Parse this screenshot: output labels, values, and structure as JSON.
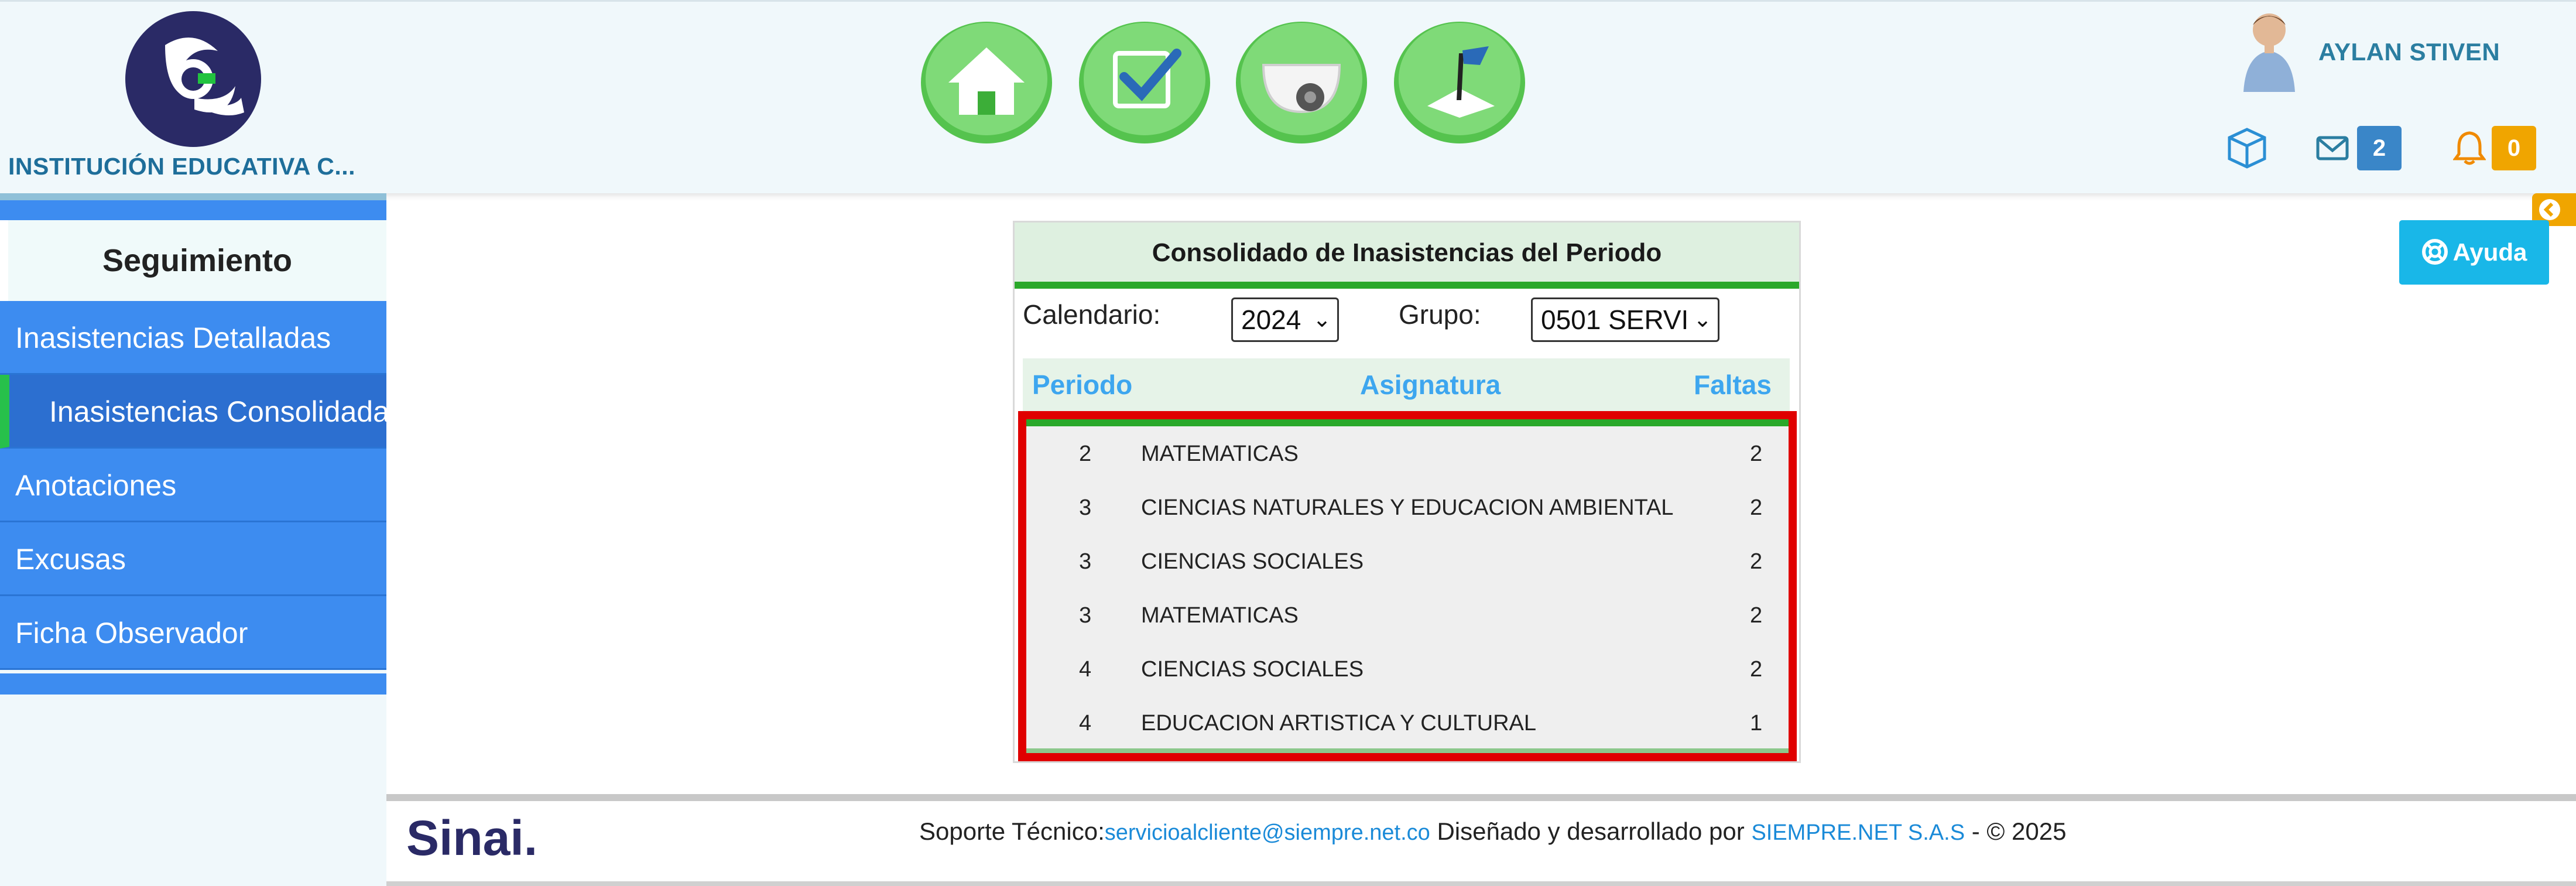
{
  "header": {
    "school_name": "INSTITUCIÓN EDUCATIVA C...",
    "nav_icons": [
      "home-icon",
      "checkbox-icon",
      "camera-icon",
      "flag-icon"
    ],
    "user_name": "AYLAN STIVEN",
    "messages_count": "2",
    "notifications_count": "0"
  },
  "sidebar": {
    "heading": "Seguimiento",
    "items": [
      {
        "label": "Inasistencias Detalladas"
      },
      {
        "label": "Inasistencias Consolidadas"
      },
      {
        "label": "Anotaciones"
      },
      {
        "label": "Excusas"
      },
      {
        "label": "Ficha Observador"
      }
    ]
  },
  "help_label": "Ayuda",
  "panel": {
    "title": "Consolidado de Inasistencias del Periodo",
    "calendar_label": "Calendario:",
    "calendar_value": "2024",
    "group_label": "Grupo:",
    "group_value": "0501 SERVI",
    "columns": [
      "Periodo",
      "Asignatura",
      "Faltas"
    ],
    "rows": [
      {
        "periodo": "2",
        "asignatura": "MATEMATICAS",
        "faltas": "2"
      },
      {
        "periodo": "3",
        "asignatura": "CIENCIAS NATURALES Y EDUCACION AMBIENTAL",
        "faltas": "2"
      },
      {
        "periodo": "3",
        "asignatura": "CIENCIAS SOCIALES",
        "faltas": "2"
      },
      {
        "periodo": "3",
        "asignatura": "MATEMATICAS",
        "faltas": "2"
      },
      {
        "periodo": "4",
        "asignatura": "CIENCIAS SOCIALES",
        "faltas": "2"
      },
      {
        "periodo": "4",
        "asignatura": "EDUCACION ARTISTICA Y CULTURAL",
        "faltas": "1"
      }
    ]
  },
  "footer": {
    "support_label": "Soporte Técnico:",
    "support_email": "servicioalcliente@siempre.net.co",
    "designed_by": " Diseñado y desarrollado por ",
    "company": "SIEMPRE.NET S.A.S",
    "copyright": " -  © 2025",
    "logo_text": "Sinai."
  },
  "colors": {
    "accent_blue": "#3d8cf0",
    "active_indicator": "#27c04b",
    "highlight_border": "#e00000",
    "badge_blue": "#3a86c8",
    "badge_orange": "#f0a500",
    "help_button": "#19b7e8"
  }
}
